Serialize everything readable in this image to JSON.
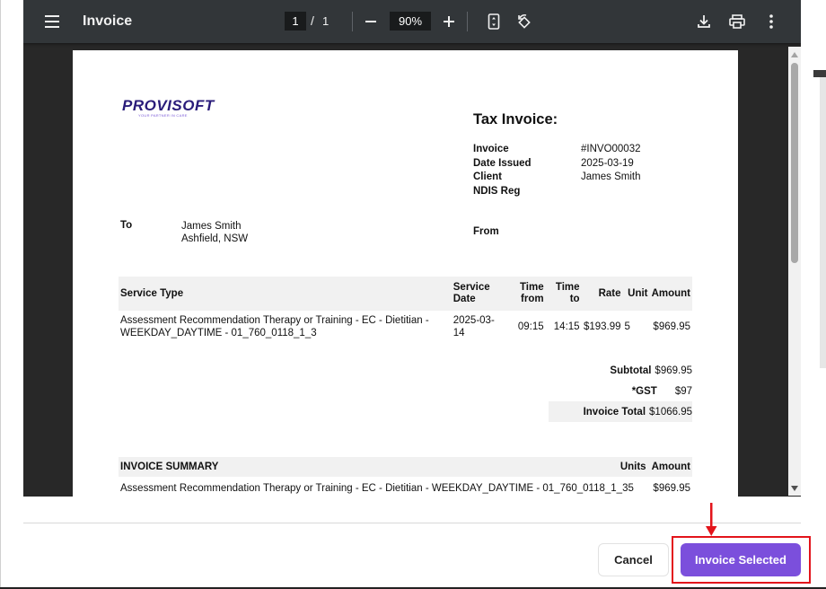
{
  "toolbar": {
    "title": "Invoice",
    "page_current": "1",
    "page_separator": "/",
    "page_total": "1",
    "zoom": "90%"
  },
  "invoice": {
    "logo_text": "PROVISOFT",
    "logo_tagline": "YOUR PARTNER IN CARE",
    "heading": "Tax Invoice:",
    "meta": [
      {
        "label": "Invoice",
        "value": "#INVO00032"
      },
      {
        "label": "Date Issued",
        "value": "2025-03-19"
      },
      {
        "label": "Client",
        "value": "James Smith"
      },
      {
        "label": "NDIS Reg",
        "value": ""
      }
    ],
    "to_label": "To",
    "to_name": "James Smith",
    "to_address": "Ashfield, NSW",
    "from_label": "From",
    "columns": {
      "service_type": "Service Type",
      "service_date": "Service Date",
      "time_from": "Time from",
      "time_to": "Time to",
      "rate": "Rate",
      "unit": "Unit",
      "amount": "Amount"
    },
    "rows": [
      {
        "service_type": "Assessment Recommendation Therapy or Training - EC - Dietitian - WEEKDAY_DAYTIME - 01_760_0118_1_3",
        "service_date": "2025-03-14",
        "time_from": "09:15",
        "time_to": "14:15",
        "rate": "$193.99",
        "unit": "5",
        "amount": "$969.95"
      }
    ],
    "subtotal_label": "Subtotal",
    "subtotal_value": "$969.95",
    "gst_label": "*GST",
    "gst_value": "$97",
    "total_label": "Invoice Total",
    "total_value": "$1066.95",
    "summary": {
      "heading": "INVOICE SUMMARY",
      "units_label": "Units",
      "amount_label": "Amount",
      "row_service": "Assessment Recommendation Therapy or Training - EC - Dietitian - WEEKDAY_DAYTIME - 01_760_0118_1_3",
      "row_units": "5",
      "row_amount": "$969.95"
    }
  },
  "footer": {
    "cancel_label": "Cancel",
    "primary_label": "Invoice Selected"
  },
  "colors": {
    "primary": "#7b4fdc",
    "highlight": "#e3141b",
    "viewer_bg": "#323639"
  }
}
